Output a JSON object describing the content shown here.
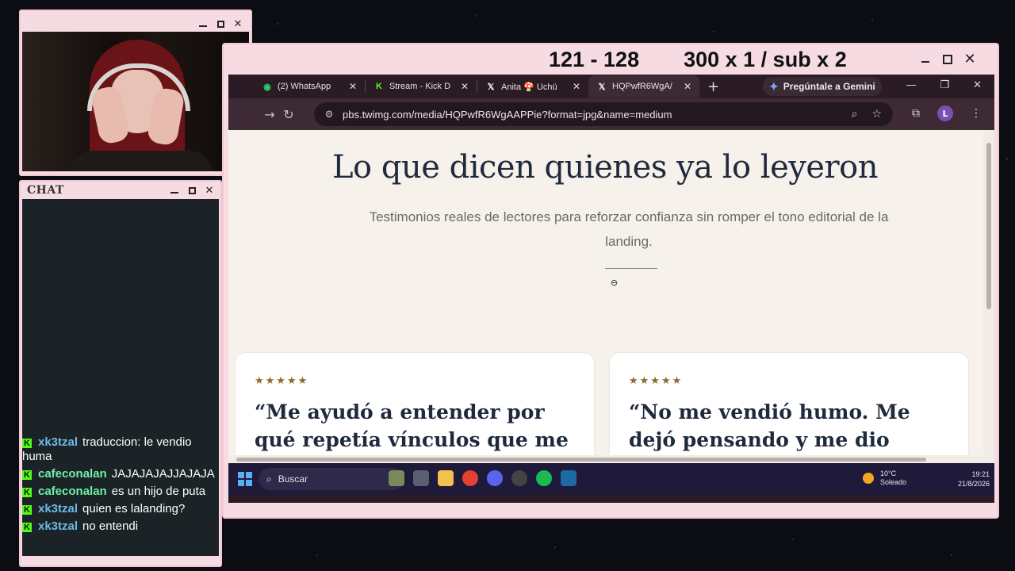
{
  "overlay": {
    "stream_title": "121 - 128",
    "stream_goal": "300 x 1 / sub x 2"
  },
  "chat": {
    "title": "CHAT",
    "messages": [
      {
        "user": "xk3tzal",
        "user_color": "#6fb8e8",
        "text": "traduccion: le vendio huma"
      },
      {
        "user": "cafeconalan",
        "user_color": "#6ff0a8",
        "text": "JAJAJAJAJJAJAJA"
      },
      {
        "user": "cafeconalan",
        "user_color": "#6ff0a8",
        "text": "es un hijo de puta"
      },
      {
        "user": "xk3tzal",
        "user_color": "#6fb8e8",
        "text": "quien es lalanding?"
      },
      {
        "user": "xk3tzal",
        "user_color": "#6fb8e8",
        "text": "no entendi"
      }
    ]
  },
  "browser": {
    "tabs": [
      {
        "label": "(2) WhatsApp",
        "icon": "whatsapp-icon",
        "icon_color": "#25d366",
        "active": false
      },
      {
        "label": "Stream - Kick D",
        "icon": "kick-icon",
        "icon_color": "#53fc18",
        "active": false
      },
      {
        "label": "Anita 🍄 Uchü",
        "icon": "x-icon",
        "icon_color": "#ffffff",
        "active": false
      },
      {
        "label": "HQPwfR6WgA/",
        "icon": "x-icon",
        "icon_color": "#ffffff",
        "active": true
      }
    ],
    "gemini_label": "Pregúntale a Gemini",
    "url": "pbs.twimg.com/media/HQPwfR6WgAAPPie?format=jpg&name=medium",
    "avatar_letter": "L"
  },
  "page": {
    "headline": "Lo que dicen quienes ya lo leyeron",
    "subhead": "Testimonios reales de lectores para reforzar confianza sin romper el tono editorial de la landing.",
    "cards": [
      {
        "stars": "★★★★★",
        "quote": "“Me ayudó a entender por qué repetía vínculos que me"
      },
      {
        "stars": "★★★★★",
        "quote": "“No me vendió humo. Me dejó pensando y me dio"
      }
    ]
  },
  "taskbar": {
    "search_placeholder": "Buscar",
    "weather_temp": "10°C",
    "weather_desc": "Soleado",
    "time": "19:21",
    "date": "21/8/2026"
  },
  "colors": {
    "window_pink": "#f7dbe3",
    "chrome_bg": "#2b1b24",
    "page_bg": "#f6f1ea",
    "headline": "#1f2a3d",
    "kick_green": "#53fc18"
  }
}
